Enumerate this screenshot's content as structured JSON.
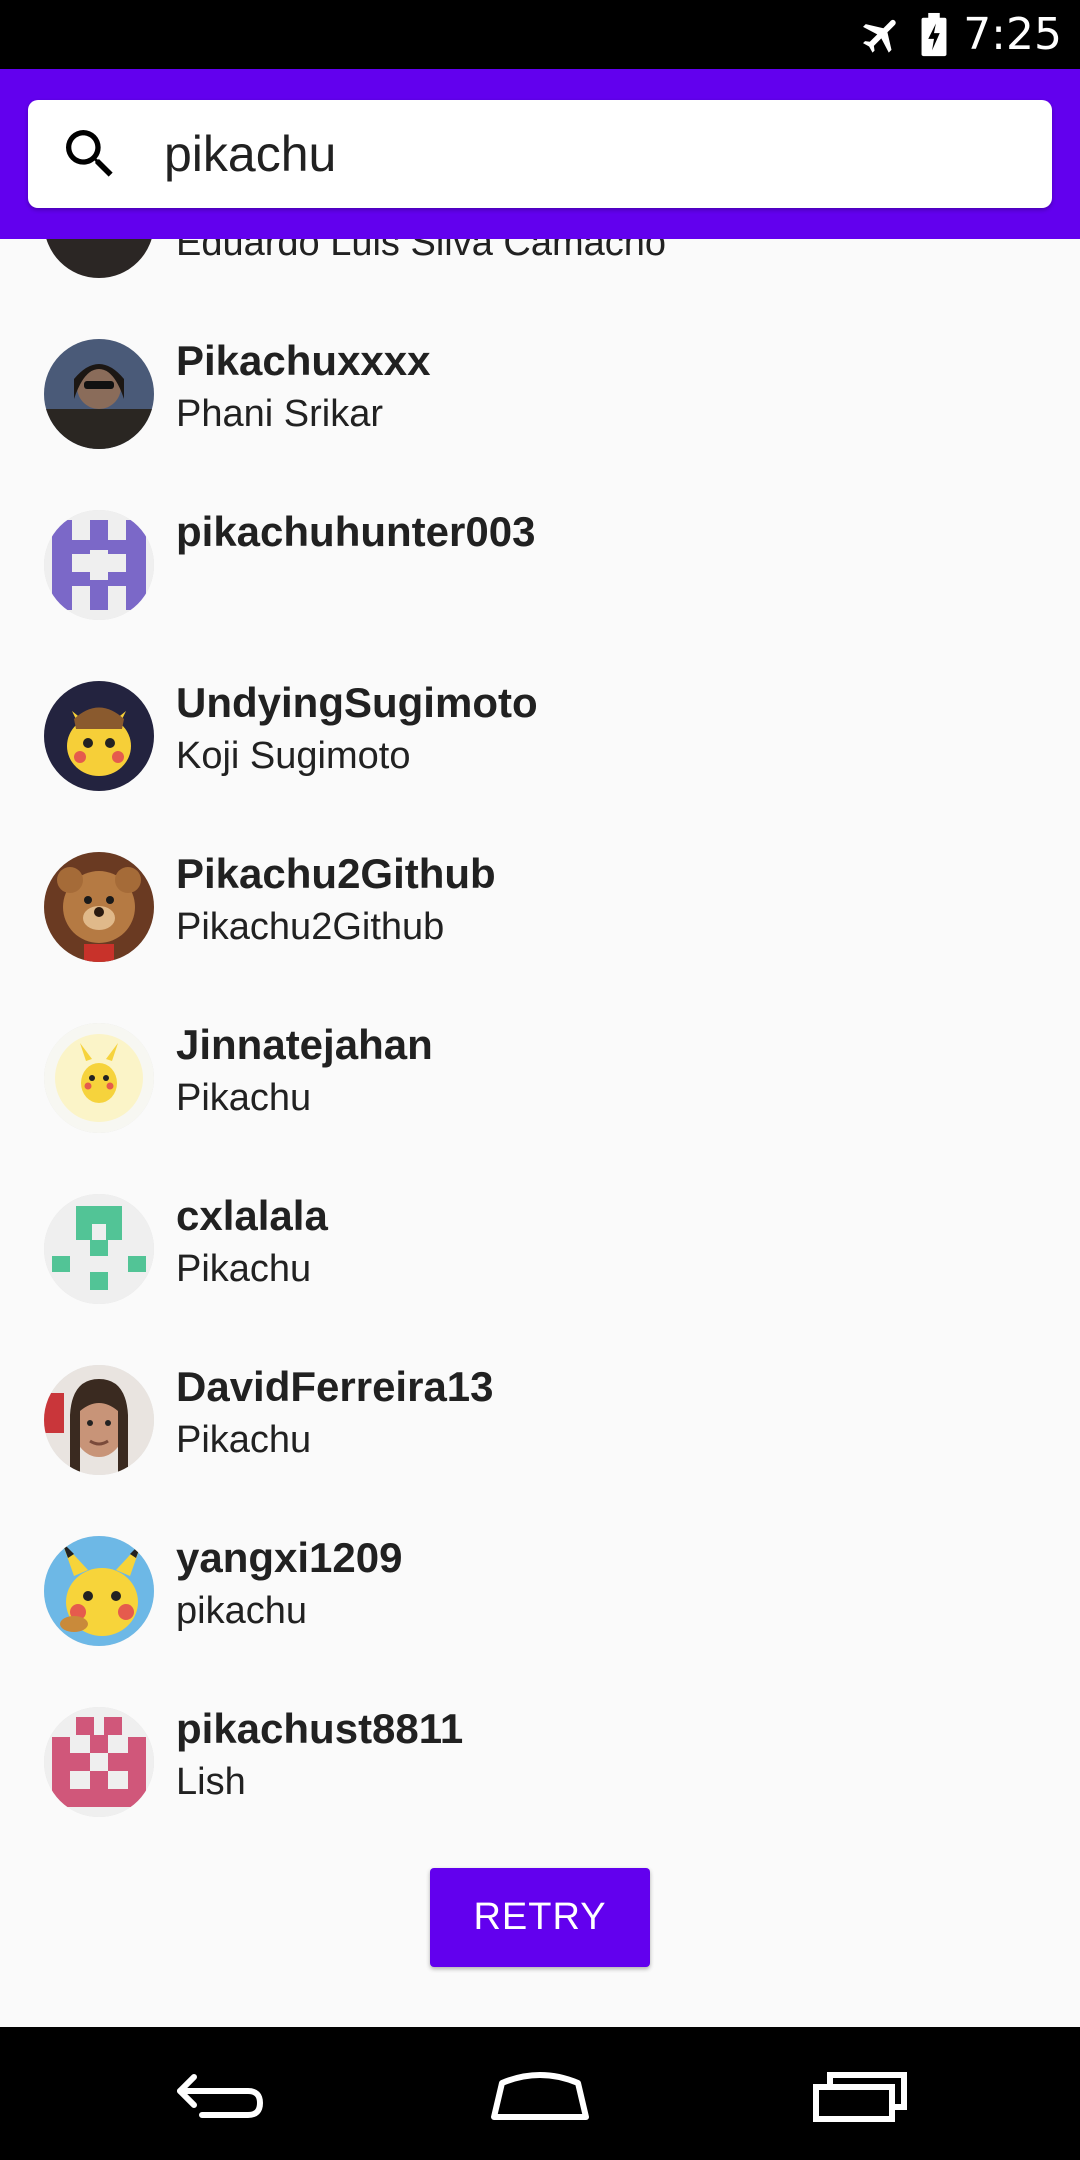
{
  "status_bar": {
    "time": "7:25",
    "icons": [
      "airplane-mode-icon",
      "battery-charging-icon"
    ]
  },
  "search": {
    "query": "pikachu",
    "icon": "search-icon"
  },
  "users": [
    {
      "login": "",
      "name": "Eduardo Luis Silva Camacho",
      "avatar": "dark-photo"
    },
    {
      "login": "Pikachuxxxx",
      "name": "Phani Srikar",
      "avatar": "photo-man-sunglasses"
    },
    {
      "login": "pikachuhunter003",
      "name": "",
      "avatar": "identicon-purple"
    },
    {
      "login": "UndyingSugimoto",
      "name": "Koji Sugimoto",
      "avatar": "pikachu-detective"
    },
    {
      "login": "Pikachu2Github",
      "name": "Pikachu2Github",
      "avatar": "teddy-bear"
    },
    {
      "login": "Jinnatejahan",
      "name": "Pikachu",
      "avatar": "pikachu-yellow"
    },
    {
      "login": "cxlalala",
      "name": "Pikachu",
      "avatar": "identicon-green"
    },
    {
      "login": "DavidFerreira13",
      "name": "Pikachu",
      "avatar": "photo-man"
    },
    {
      "login": "yangxi1209",
      "name": "pikachu",
      "avatar": "pikachu-blue-bg"
    },
    {
      "login": "pikachust8811",
      "name": "Lish",
      "avatar": "identicon-pink"
    }
  ],
  "retry": {
    "label": "RETRY"
  },
  "nav": {
    "back_icon": "back-icon",
    "home_icon": "home-icon",
    "recents_icon": "recents-icon"
  },
  "colors": {
    "primary": "#6200ee",
    "background": "#fafafa",
    "text": "#212121"
  }
}
